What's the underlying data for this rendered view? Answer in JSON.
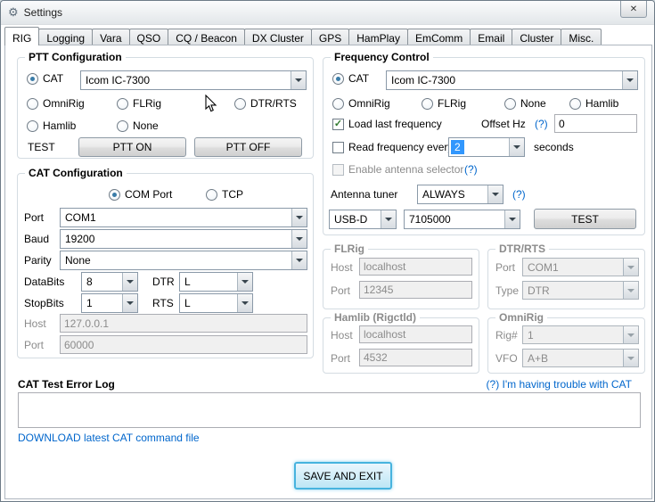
{
  "window": {
    "title": "Settings"
  },
  "icons": {
    "app": "⚙",
    "close": "✕",
    "check": "✓"
  },
  "tabs": [
    "RIG",
    "Logging",
    "Vara",
    "QSO",
    "CQ / Beacon",
    "DX Cluster",
    "GPS",
    "HamPlay",
    "EmComm",
    "Email",
    "Cluster",
    "Misc."
  ],
  "ptt": {
    "title": "PTT Configuration",
    "cat": "CAT",
    "cat_device": "Icom IC-7300",
    "omnirig": "OmniRig",
    "flrig": "FLRig",
    "dtrrts": "DTR/RTS",
    "hamlib": "Hamlib",
    "none": "None",
    "test": "TEST",
    "ptt_on": "PTT ON",
    "ptt_off": "PTT OFF"
  },
  "cat": {
    "title": "CAT Configuration",
    "com_port": "COM Port",
    "tcp": "TCP",
    "port_label": "Port",
    "port": "COM1",
    "baud_label": "Baud",
    "baud": "19200",
    "parity_label": "Parity",
    "parity": "None",
    "databits_label": "DataBits",
    "databits": "8",
    "dtr_label": "DTR",
    "dtr": "L",
    "stopbits_label": "StopBits",
    "stopbits": "1",
    "rts_label": "RTS",
    "rts": "L",
    "host_label": "Host",
    "host": "127.0.0.1",
    "tcp_port_label": "Port",
    "tcp_port": "60000"
  },
  "freq": {
    "title": "Frequency Control",
    "cat": "CAT",
    "cat_device": "Icom IC-7300",
    "omnirig": "OmniRig",
    "flrig": "FLRig",
    "none": "None",
    "hamlib": "Hamlib",
    "load_last": "Load last frequency",
    "offset_label": "Offset Hz",
    "offset_help": "(?)",
    "offset": "0",
    "read_every": "Read frequency every",
    "read_interval": "2",
    "seconds": "seconds",
    "antenna_selector": "Enable antenna selector",
    "antenna_selector_help": "(?)",
    "antenna_tuner_label": "Antenna tuner",
    "antenna_tuner": "ALWAYS",
    "antenna_tuner_help": "(?)",
    "mode": "USB-D",
    "frequency": "7105000",
    "test": "TEST"
  },
  "flrig": {
    "title": "FLRig",
    "host_label": "Host",
    "host": "localhost",
    "port_label": "Port",
    "port": "12345"
  },
  "dtrrts": {
    "title": "DTR/RTS",
    "port_label": "Port",
    "port": "COM1",
    "type_label": "Type",
    "type": "DTR"
  },
  "hamlib": {
    "title": "Hamlib (Rigctld)",
    "host_label": "Host",
    "host": "localhost",
    "port_label": "Port",
    "port": "4532"
  },
  "omnirig": {
    "title": "OmniRig",
    "rig_label": "Rig#",
    "rig": "1",
    "vfo_label": "VFO",
    "vfo": "A+B"
  },
  "errorlog": {
    "title": "CAT Test Error Log",
    "trouble_link": "(?) I'm having trouble with CAT",
    "log": "",
    "download_link": "DOWNLOAD latest CAT command file"
  },
  "footer": {
    "save": "SAVE AND EXIT"
  },
  "colors": {
    "link": "#0066cc",
    "save_border": "#47b3de",
    "selection_blue": "#3297fd"
  }
}
